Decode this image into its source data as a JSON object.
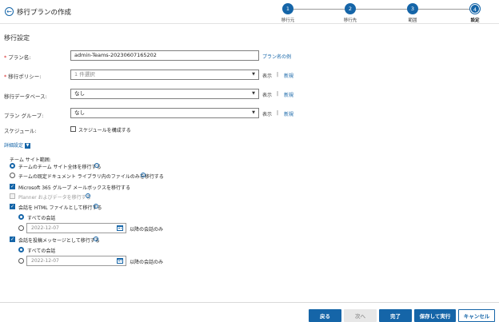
{
  "header": {
    "back_icon": "arrow-left-circle-icon",
    "title": "移行プランの作成",
    "steps": [
      {
        "number": "1",
        "label": "移行元"
      },
      {
        "number": "2",
        "label": "移行先"
      },
      {
        "number": "3",
        "label": "範囲"
      },
      {
        "number": "4",
        "label": "設定",
        "current": true
      }
    ]
  },
  "form": {
    "section_title": "移行設定",
    "plan_name": {
      "label": "プラン名:",
      "value": "admin-Teams-20230607165202",
      "example_link": "プラン名の例"
    },
    "policy": {
      "label": "移行ポリシー:",
      "value": "1 件選択",
      "show": "表示",
      "separator": "|",
      "new": "新規"
    },
    "database": {
      "label": "移行データベース:",
      "value": "なし",
      "show": "表示",
      "separator": "|",
      "new": "新規"
    },
    "plan_group": {
      "label": "プラン グループ:",
      "value": "なし",
      "show": "表示",
      "separator": "|",
      "new": "新規"
    },
    "schedule": {
      "label": "スケジュール:",
      "checkbox_label": "スケジュールを構成する"
    }
  },
  "advanced": {
    "toggle_label": "詳細設定",
    "team_site_scope_label": "チーム サイト範囲:",
    "scope_option_all": "チームのチーム サイト全体を移行する",
    "scope_option_default_lib": "チームの既定ドキュメント ライブラリ内のファイルのみを移行する",
    "m365_group_mailbox": "Microsoft 365 グループ メールボックスを移行する",
    "planner": "Planner およびデータを移行する",
    "conv_html": "会話を HTML ファイルとして移行する",
    "conv_html_all": "すべての会話",
    "conv_html_date": "2022-12-07",
    "conv_html_after": "以降の会話のみ",
    "conv_post": "会話を投稿メッセージとして移行する",
    "conv_post_all": "すべての会話",
    "conv_post_date": "2022-12-07",
    "conv_post_after": "以降の会話のみ"
  },
  "footer": {
    "back": "戻る",
    "next": "次へ",
    "finish": "完了",
    "save_run": "保存して実行",
    "cancel": "キャンセル"
  },
  "colors": {
    "accent": "#1565a8",
    "required": "#d62020"
  }
}
